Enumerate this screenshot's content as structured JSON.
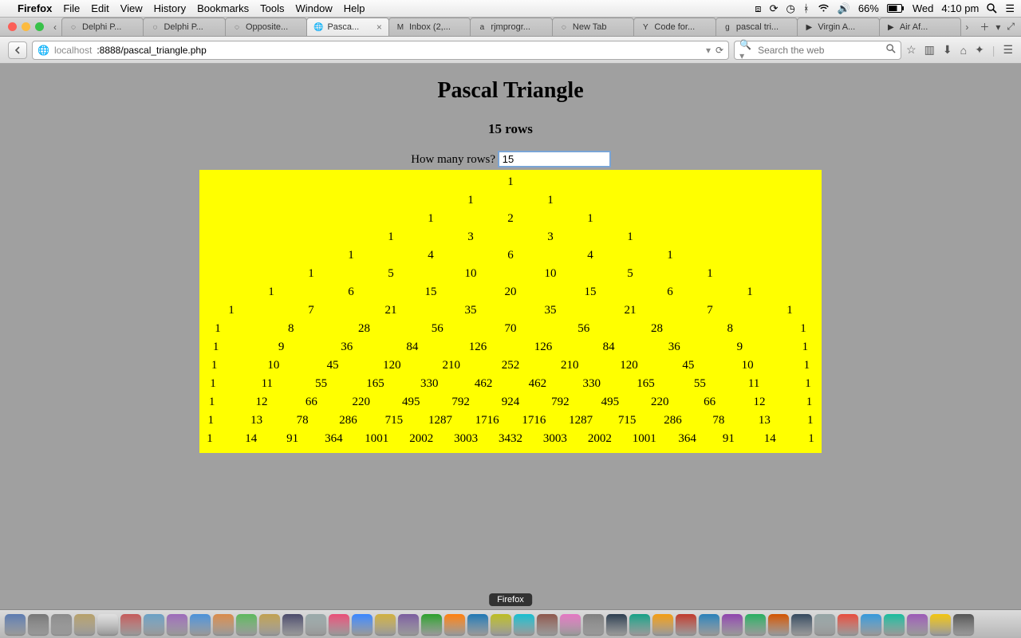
{
  "menubar": {
    "app": "Firefox",
    "items": [
      "File",
      "Edit",
      "View",
      "History",
      "Bookmarks",
      "Tools",
      "Window",
      "Help"
    ],
    "status": {
      "battery": "66%",
      "day": "Wed",
      "time": "4:10 pm"
    }
  },
  "tabs": {
    "items": [
      {
        "label": "Delphi P...",
        "active": false
      },
      {
        "label": "Delphi P...",
        "active": false
      },
      {
        "label": "Opposite...",
        "active": false
      },
      {
        "label": "Pasca...",
        "active": true
      },
      {
        "label": "Inbox (2,...",
        "active": false
      },
      {
        "label": "rjmprogr...",
        "active": false
      },
      {
        "label": "New Tab",
        "active": false
      },
      {
        "label": "Code for...",
        "active": false
      },
      {
        "label": "pascal tri...",
        "active": false
      },
      {
        "label": "Virgin A...",
        "active": false
      },
      {
        "label": "Air Af...",
        "active": false
      }
    ]
  },
  "toolbar": {
    "url_host": "localhost",
    "url_rest": ":8888/pascal_triangle.php",
    "search_placeholder": "Search the web"
  },
  "page": {
    "title": "Pascal Triangle",
    "subtitle": "15 rows",
    "prompt": "How many rows?",
    "input_value": "15",
    "triangle_rows": [
      [
        1
      ],
      [
        1,
        1
      ],
      [
        1,
        2,
        1
      ],
      [
        1,
        3,
        3,
        1
      ],
      [
        1,
        4,
        6,
        4,
        1
      ],
      [
        1,
        5,
        10,
        10,
        5,
        1
      ],
      [
        1,
        6,
        15,
        20,
        15,
        6,
        1
      ],
      [
        1,
        7,
        21,
        35,
        35,
        21,
        7,
        1
      ],
      [
        1,
        8,
        28,
        56,
        70,
        56,
        28,
        8,
        1
      ],
      [
        1,
        9,
        36,
        84,
        126,
        126,
        84,
        36,
        9,
        1
      ],
      [
        1,
        10,
        45,
        120,
        210,
        252,
        210,
        120,
        45,
        10,
        1
      ],
      [
        1,
        11,
        55,
        165,
        330,
        462,
        462,
        330,
        165,
        55,
        11,
        1
      ],
      [
        1,
        12,
        66,
        220,
        495,
        792,
        924,
        792,
        495,
        220,
        66,
        12,
        1
      ],
      [
        1,
        13,
        78,
        286,
        715,
        1287,
        1716,
        1716,
        1287,
        715,
        286,
        78,
        13,
        1
      ],
      [
        1,
        14,
        91,
        364,
        1001,
        2002,
        3003,
        3432,
        3003,
        2002,
        1001,
        364,
        91,
        14,
        1
      ]
    ]
  },
  "dock": {
    "hover_label": "Firefox",
    "count": 42
  },
  "chart_data": {
    "type": "table",
    "title": "Pascal Triangle",
    "rows": 15,
    "data": [
      [
        1
      ],
      [
        1,
        1
      ],
      [
        1,
        2,
        1
      ],
      [
        1,
        3,
        3,
        1
      ],
      [
        1,
        4,
        6,
        4,
        1
      ],
      [
        1,
        5,
        10,
        10,
        5,
        1
      ],
      [
        1,
        6,
        15,
        20,
        15,
        6,
        1
      ],
      [
        1,
        7,
        21,
        35,
        35,
        21,
        7,
        1
      ],
      [
        1,
        8,
        28,
        56,
        70,
        56,
        28,
        8,
        1
      ],
      [
        1,
        9,
        36,
        84,
        126,
        126,
        84,
        36,
        9,
        1
      ],
      [
        1,
        10,
        45,
        120,
        210,
        252,
        210,
        120,
        45,
        10,
        1
      ],
      [
        1,
        11,
        55,
        165,
        330,
        462,
        462,
        330,
        165,
        55,
        11,
        1
      ],
      [
        1,
        12,
        66,
        220,
        495,
        792,
        924,
        792,
        495,
        220,
        66,
        12,
        1
      ],
      [
        1,
        13,
        78,
        286,
        715,
        1287,
        1716,
        1716,
        1287,
        715,
        286,
        78,
        13,
        1
      ],
      [
        1,
        14,
        91,
        364,
        1001,
        2002,
        3003,
        3432,
        3003,
        2002,
        1001,
        364,
        91,
        14,
        1
      ]
    ]
  }
}
